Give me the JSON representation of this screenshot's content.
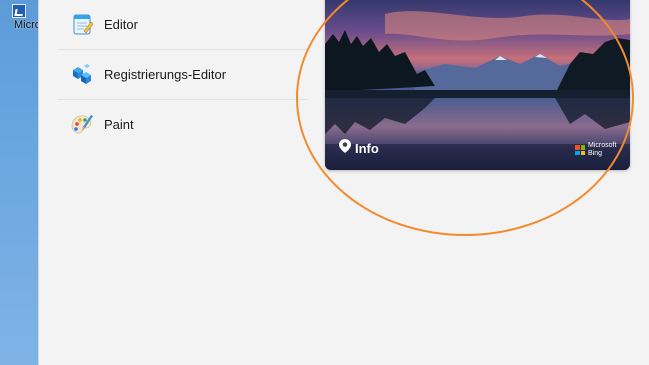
{
  "desktop": {
    "icon_label": "Micro"
  },
  "apps": [
    {
      "label": "Editor",
      "icon": "notepad-icon"
    },
    {
      "label": "Registrierungs-Editor",
      "icon": "regedit-icon"
    },
    {
      "label": "Paint",
      "icon": "paint-icon"
    }
  ],
  "wallpaper": {
    "info_label": "Info",
    "brand_line1": "Microsoft",
    "brand_line2": "Bing"
  },
  "colors": {
    "panel_bg": "#f3f3f3",
    "highlight_ring": "#f28a2e",
    "desktop_bg": "#6aa6e0"
  }
}
